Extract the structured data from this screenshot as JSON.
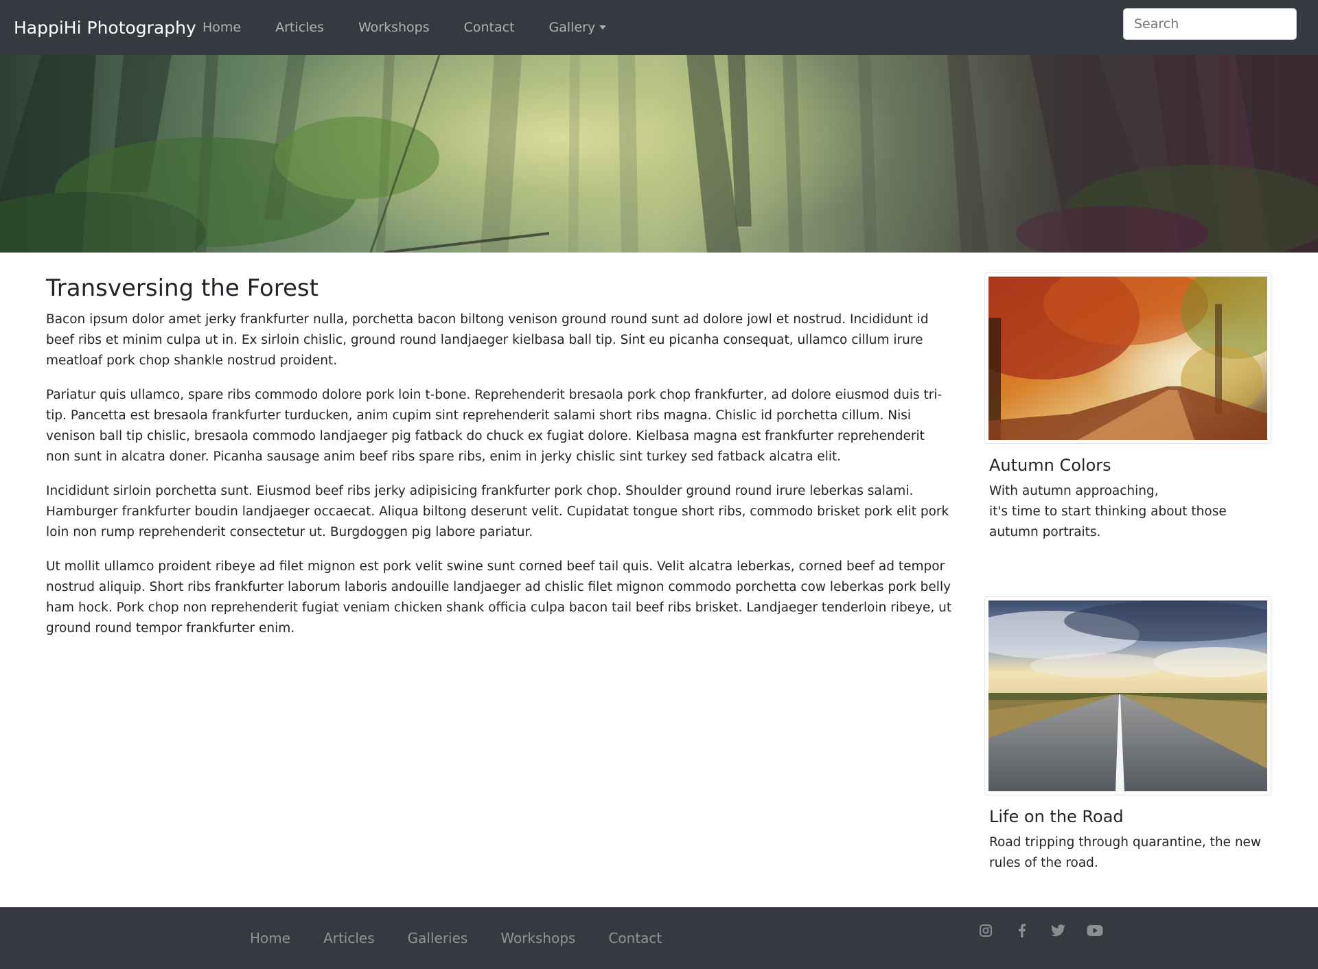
{
  "navbar": {
    "brand": "HappiHi Photography",
    "links": [
      {
        "label": "Home"
      },
      {
        "label": "Articles"
      },
      {
        "label": "Workshops"
      },
      {
        "label": "Contact"
      },
      {
        "label": "Gallery"
      }
    ],
    "search_placeholder": "Search"
  },
  "article": {
    "title": "Transversing the Forest",
    "paragraphs": [
      "Bacon ipsum dolor amet jerky frankfurter nulla, porchetta bacon biltong venison ground round sunt ad dolore jowl et nostrud. Incididunt id beef ribs et minim culpa ut in. Ex sirloin chislic, ground round landjaeger kielbasa ball tip. Sint eu picanha consequat, ullamco cillum irure meatloaf pork chop shankle nostrud proident.",
      "Pariatur quis ullamco, spare ribs commodo dolore pork loin t-bone. Reprehenderit bresaola pork chop frankfurter, ad dolore eiusmod duis tri-tip. Pancetta est bresaola frankfurter turducken, anim cupim sint reprehenderit salami short ribs magna. Chislic id porchetta cillum. Nisi venison ball tip chislic, bresaola commodo landjaeger pig fatback do chuck ex fugiat dolore. Kielbasa magna est frankfurter reprehenderit non sunt in alcatra doner. Picanha sausage anim beef ribs spare ribs, enim in jerky chislic sint turkey sed fatback alcatra elit.",
      "Incididunt sirloin porchetta sunt. Eiusmod beef ribs jerky adipisicing frankfurter pork chop. Shoulder ground round irure leberkas salami. Hamburger frankfurter boudin landjaeger occaecat. Aliqua biltong deserunt velit. Cupidatat tongue short ribs, commodo brisket pork elit pork loin non rump reprehenderit consectetur ut. Burgdoggen pig labore pariatur.",
      "Ut mollit ullamco proident ribeye ad filet mignon est pork velit swine sunt corned beef tail quis. Velit alcatra leberkas, corned beef ad tempor nostrud aliquip. Short ribs frankfurter laborum laboris andouille landjaeger ad chislic filet mignon commodo porchetta cow leberkas pork belly ham hock. Pork chop non reprehenderit fugiat veniam chicken shank officia culpa bacon tail beef ribs brisket. Landjaeger tenderloin ribeye, ut ground round tempor frankfurter enim."
    ]
  },
  "cards": [
    {
      "title": "Autumn Colors",
      "text": "With autumn approaching,\nit's time to start thinking about those autumn portraits."
    },
    {
      "title": "Life on the Road",
      "text": "Road tripping through quarantine, the new rules of the road."
    }
  ],
  "footer": {
    "links": [
      {
        "label": "Home"
      },
      {
        "label": "Articles"
      },
      {
        "label": "Galleries"
      },
      {
        "label": "Workshops"
      },
      {
        "label": "Contact"
      }
    ],
    "social_icons": [
      "instagram-icon",
      "facebook-icon",
      "twitter-icon",
      "youtube-icon"
    ]
  },
  "colors": {
    "navbar_bg": "#343a40",
    "footer_bg": "#343a40",
    "text": "#212529"
  }
}
